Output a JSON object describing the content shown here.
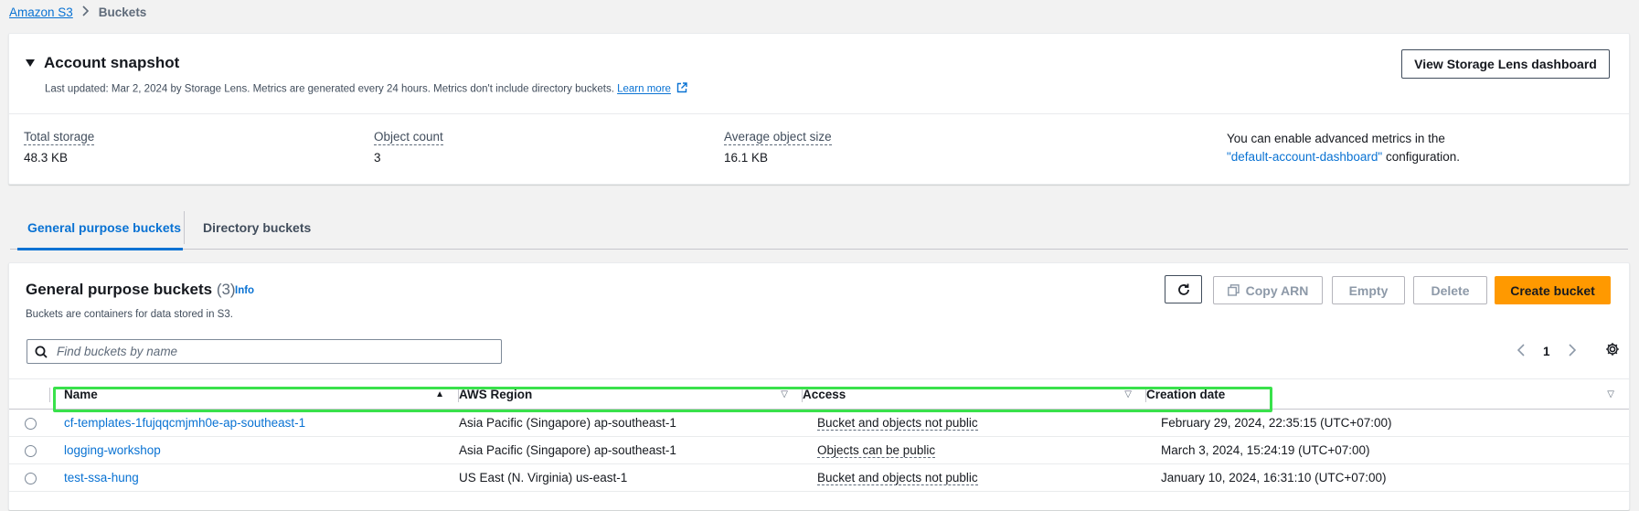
{
  "breadcrumb": {
    "root": "Amazon S3",
    "current": "Buckets"
  },
  "snapshot": {
    "title": "Account snapshot",
    "subtitle": "Last updated: Mar 2, 2024 by Storage Lens. Metrics are generated every 24 hours. Metrics don't include directory buckets.",
    "learn_more": "Learn more",
    "lens_button": "View Storage Lens dashboard",
    "metrics": [
      {
        "label": "Total storage",
        "value": "48.3 KB"
      },
      {
        "label": "Object count",
        "value": "3"
      },
      {
        "label": "Average object size",
        "value": "16.1 KB"
      }
    ],
    "advanced_line1": "You can enable advanced metrics in the",
    "advanced_link": "\"default-account-dashboard\"",
    "advanced_line2": " configuration."
  },
  "tabs": [
    {
      "label": "General purpose buckets",
      "active": true
    },
    {
      "label": "Directory buckets",
      "active": false
    }
  ],
  "buckets": {
    "title": "General purpose buckets",
    "count": "(3)",
    "info": "Info",
    "description": "Buckets are containers for data stored in S3.",
    "buttons": {
      "copy_arn": "Copy ARN",
      "empty": "Empty",
      "delete": "Delete",
      "create": "Create bucket"
    },
    "search_placeholder": "Find buckets by name",
    "page": "1",
    "columns": [
      "Name",
      "AWS Region",
      "Access",
      "Creation date"
    ],
    "rows": [
      {
        "name": "cf-templates-1fujqqcmjmh0e-ap-southeast-1",
        "region": "Asia Pacific (Singapore) ap-southeast-1",
        "access": "Bucket and objects not public",
        "created": "February 29, 2024, 22:35:15 (UTC+07:00)"
      },
      {
        "name": "logging-workshop",
        "region": "Asia Pacific (Singapore) ap-southeast-1",
        "access": "Objects can be public",
        "created": "March 3, 2024, 15:24:19 (UTC+07:00)"
      },
      {
        "name": "test-ssa-hung",
        "region": "US East (N. Virginia) us-east-1",
        "access": "Bucket and objects not public",
        "created": "January 10, 2024, 16:31:10 (UTC+07:00)"
      }
    ]
  },
  "colors": {
    "link": "#0972d3",
    "primary_button": "#ff9900",
    "highlight": "#39e14b"
  }
}
